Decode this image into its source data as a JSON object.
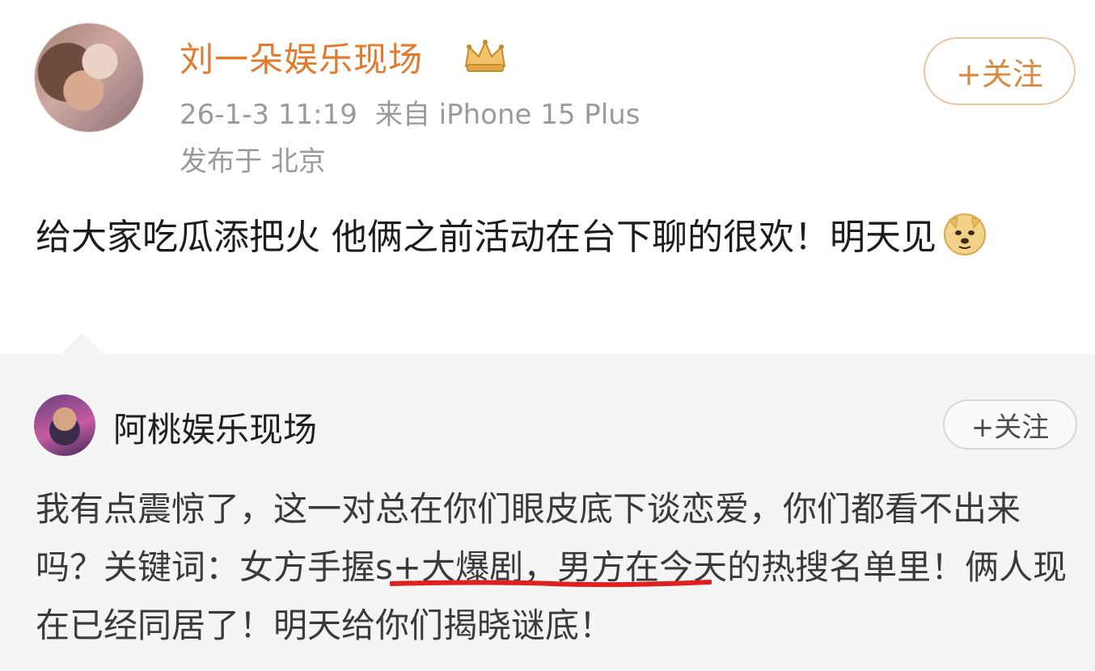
{
  "post": {
    "username": "刘一朵娱乐现场",
    "time": "26-1-3 11:19",
    "source": "来自 iPhone 15 Plus",
    "location": "发布于 北京",
    "follow_label": "+关注",
    "text": "给大家吃瓜添把火 他俩之前活动在台下聊的很欢！明天见"
  },
  "repost": {
    "username": "阿桃娱乐现场",
    "follow_label": "+关注",
    "text": "我有点震惊了，这一对总在你们眼皮底下谈恋爱，你们都看不出来吗？关键词：女方手握s+大爆剧，男方在今天的热搜名单里！俩人现在已经同居了！明天给你们揭晓谜底！"
  },
  "icons": {
    "crown": "crown-icon",
    "emoji": "doge-emoji-icon"
  },
  "colors": {
    "username_main": "#e07b2e",
    "follow_main": "#d98a3f",
    "meta_gray": "#9a9a9a",
    "repost_bg": "#f5f5f5",
    "underline_red": "#e02020"
  }
}
